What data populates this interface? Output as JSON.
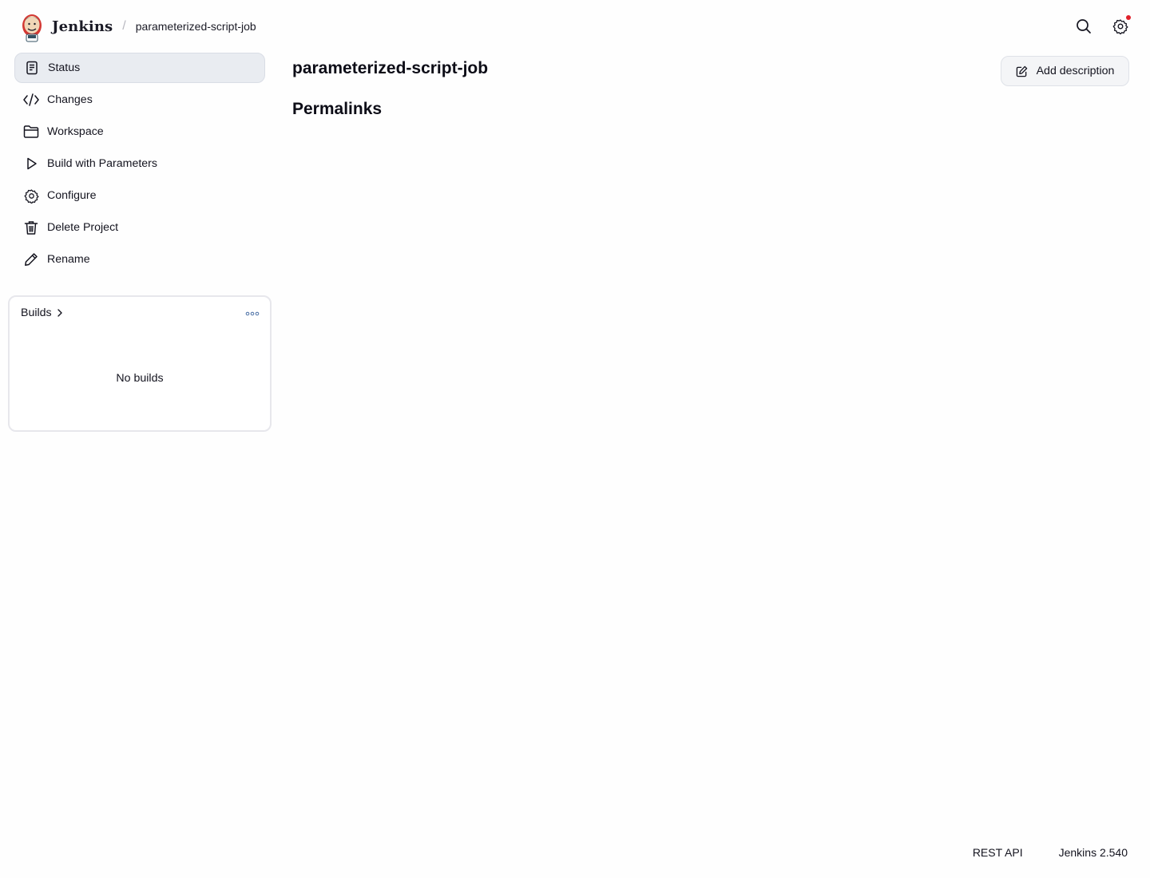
{
  "header": {
    "brand": "Jenkins",
    "breadcrumb_separator": "/",
    "breadcrumb_job": "parameterized-script-job",
    "icons": [
      "jenkins-logo-icon",
      "search-icon",
      "settings-gear-icon"
    ],
    "notification_color": "#e0202a"
  },
  "sidebar": {
    "items": [
      {
        "label": "Status",
        "icon": "status-document-icon",
        "active": true
      },
      {
        "label": "Changes",
        "icon": "code-brackets-icon"
      },
      {
        "label": "Workspace",
        "icon": "folder-icon"
      },
      {
        "label": "Build with Parameters",
        "icon": "play-icon"
      },
      {
        "label": "Configure",
        "icon": "gear-icon"
      },
      {
        "label": "Delete Project",
        "icon": "trash-icon"
      },
      {
        "label": "Rename",
        "icon": "pencil-icon"
      }
    ]
  },
  "builds": {
    "title": "Builds",
    "empty_text": "No builds",
    "icons": [
      "chevron-right-icon",
      "more-dots-icon"
    ]
  },
  "main": {
    "job_title": "parameterized-script-job",
    "section_title": "Permalinks",
    "add_description_label": "Add description"
  },
  "footer": {
    "rest_api": "REST API",
    "version": "Jenkins 2.540"
  }
}
